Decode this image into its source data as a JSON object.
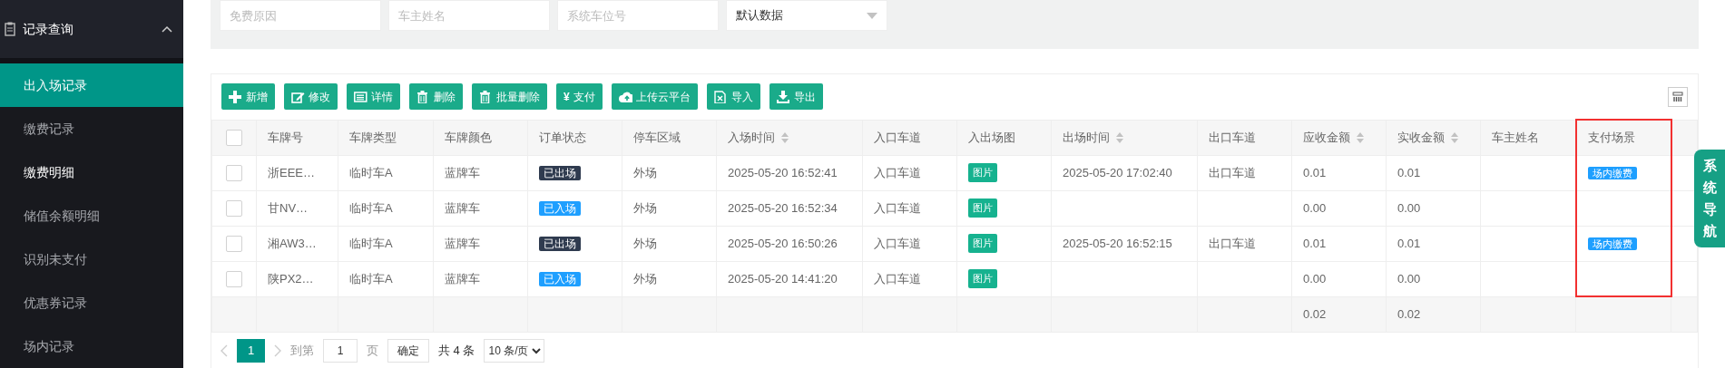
{
  "sidebar": {
    "section": {
      "label": "记录查询",
      "expanded": true
    },
    "items": [
      {
        "label": "出入场记录",
        "selected": true,
        "hovered": false
      },
      {
        "label": "缴费记录",
        "selected": false,
        "hovered": false
      },
      {
        "label": "缴费明细",
        "selected": false,
        "hovered": true
      },
      {
        "label": "储值余额明细",
        "selected": false,
        "hovered": false
      },
      {
        "label": "识别未支付",
        "selected": false,
        "hovered": false
      },
      {
        "label": "优惠券记录",
        "selected": false,
        "hovered": false
      },
      {
        "label": "场内记录",
        "selected": false,
        "hovered": false
      }
    ]
  },
  "filters": [
    {
      "kind": "input",
      "placeholder": "免费原因"
    },
    {
      "kind": "input",
      "placeholder": "车主姓名"
    },
    {
      "kind": "input",
      "placeholder": "系统车位号"
    },
    {
      "kind": "select",
      "value": "默认数据"
    }
  ],
  "toolbar": {
    "buttons": [
      {
        "label": "新增"
      },
      {
        "label": "修改"
      },
      {
        "label": "详情"
      },
      {
        "label": "删除"
      },
      {
        "label": "批量删除"
      },
      {
        "label": "支付",
        "glyph": "¥"
      },
      {
        "label": "上传云平台"
      },
      {
        "label": "导入"
      },
      {
        "label": "导出"
      }
    ]
  },
  "table": {
    "header_checked": false,
    "columns": [
      {
        "label": "车牌号",
        "sortable": false,
        "highlighted": false
      },
      {
        "label": "车牌类型",
        "sortable": false,
        "highlighted": false
      },
      {
        "label": "车牌颜色",
        "sortable": false,
        "highlighted": false
      },
      {
        "label": "订单状态",
        "sortable": false,
        "highlighted": false
      },
      {
        "label": "停车区域",
        "sortable": false,
        "highlighted": false
      },
      {
        "label": "入场时间",
        "sortable": true,
        "highlighted": false
      },
      {
        "label": "入口车道",
        "sortable": false,
        "highlighted": false
      },
      {
        "label": "入出场图",
        "sortable": false,
        "highlighted": false
      },
      {
        "label": "出场时间",
        "sortable": true,
        "highlighted": false
      },
      {
        "label": "出口车道",
        "sortable": false,
        "highlighted": false
      },
      {
        "label": "应收金额",
        "sortable": true,
        "highlighted": false,
        "total": "0.02"
      },
      {
        "label": "实收金额",
        "sortable": true,
        "highlighted": false,
        "total": "0.02"
      },
      {
        "label": "车主姓名",
        "sortable": false,
        "highlighted": false
      },
      {
        "label": "支付场景",
        "sortable": false,
        "highlighted": true
      }
    ],
    "rows": [
      {
        "checked": false,
        "plate": "浙EEE…",
        "plate_type": "临时车A",
        "plate_color": "蓝牌车",
        "order_status": {
          "text": "已出场",
          "color": "#2f3b4f"
        },
        "area": "外场",
        "entry_time": "2025-05-20 16:52:41",
        "entry_lane": "入口车道",
        "photo": "图片",
        "exit_time": "2025-05-20 17:02:40",
        "exit_lane": "出口车道",
        "receivable": "0.01",
        "received": "0.01",
        "pay_scene": {
          "text": "场内缴费",
          "color": "#1e9fff"
        }
      },
      {
        "checked": false,
        "plate": "甘NV…",
        "plate_type": "临时车A",
        "plate_color": "蓝牌车",
        "order_status": {
          "text": "已入场",
          "color": "#1e9fff"
        },
        "area": "外场",
        "entry_time": "2025-05-20 16:52:34",
        "entry_lane": "入口车道",
        "photo": "图片",
        "receivable": "0.00",
        "received": "0.00"
      },
      {
        "checked": false,
        "plate": "湘AW3…",
        "plate_type": "临时车A",
        "plate_color": "蓝牌车",
        "order_status": {
          "text": "已出场",
          "color": "#2f3b4f"
        },
        "area": "外场",
        "entry_time": "2025-05-20 16:50:26",
        "entry_lane": "入口车道",
        "photo": "图片",
        "exit_time": "2025-05-20 16:52:15",
        "exit_lane": "出口车道",
        "receivable": "0.01",
        "received": "0.01",
        "pay_scene": {
          "text": "场内缴费",
          "color": "#1e9fff"
        }
      },
      {
        "checked": false,
        "plate": "陕PX2…",
        "plate_type": "临时车A",
        "plate_color": "蓝牌车",
        "order_status": {
          "text": "已入场",
          "color": "#1e9fff"
        },
        "area": "外场",
        "entry_time": "2025-05-20 14:41:20",
        "entry_lane": "入口车道",
        "photo": "图片",
        "receivable": "0.00",
        "received": "0.00"
      }
    ]
  },
  "pagination": {
    "pages": [
      {
        "label": "1",
        "selected": true
      }
    ],
    "goto_label": "到第",
    "page_input": "1",
    "page_unit": "页",
    "confirm": "确定",
    "total": "共 4 条",
    "page_size": "10 条/页"
  },
  "nav_tab": {
    "label": "系统导航"
  }
}
